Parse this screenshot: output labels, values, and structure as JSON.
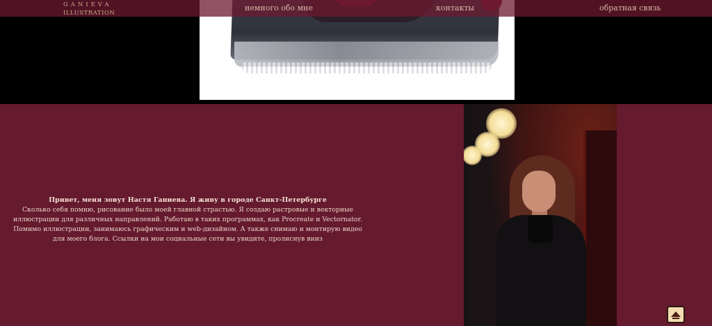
{
  "nav": {
    "logo_top": "GANIEVA",
    "logo_bottom": "ILLUSTRATION",
    "links": [
      {
        "label": "немного обо мне"
      },
      {
        "label": "контакты"
      },
      {
        "label": "обратная связь"
      }
    ]
  },
  "about": {
    "title": "Привет, меня зовут Настя Ганиева. Я живу в городе Санкт-Петербурге",
    "body": "Сколько себя помню, рисование было моей главной страстью. Я создаю растровые и векторные иллюстрации для различных направлений. Работаю в таких программах, как Procreate и Vectornator. Помимо иллюстрации, занимаюсь графическим и web-дизайном. А также снимаю и монтирую видео для моего блога. Ссылки на мои социальные сети вы увидите, пролиснув вниз"
  },
  "icons": {
    "scroll_top": "arrow-up-icon"
  },
  "colors": {
    "nav_bg": "#6c1a30",
    "section_bg": "#651a2d",
    "text": "#ecd6c9",
    "button_bg": "#f4ddb0"
  }
}
